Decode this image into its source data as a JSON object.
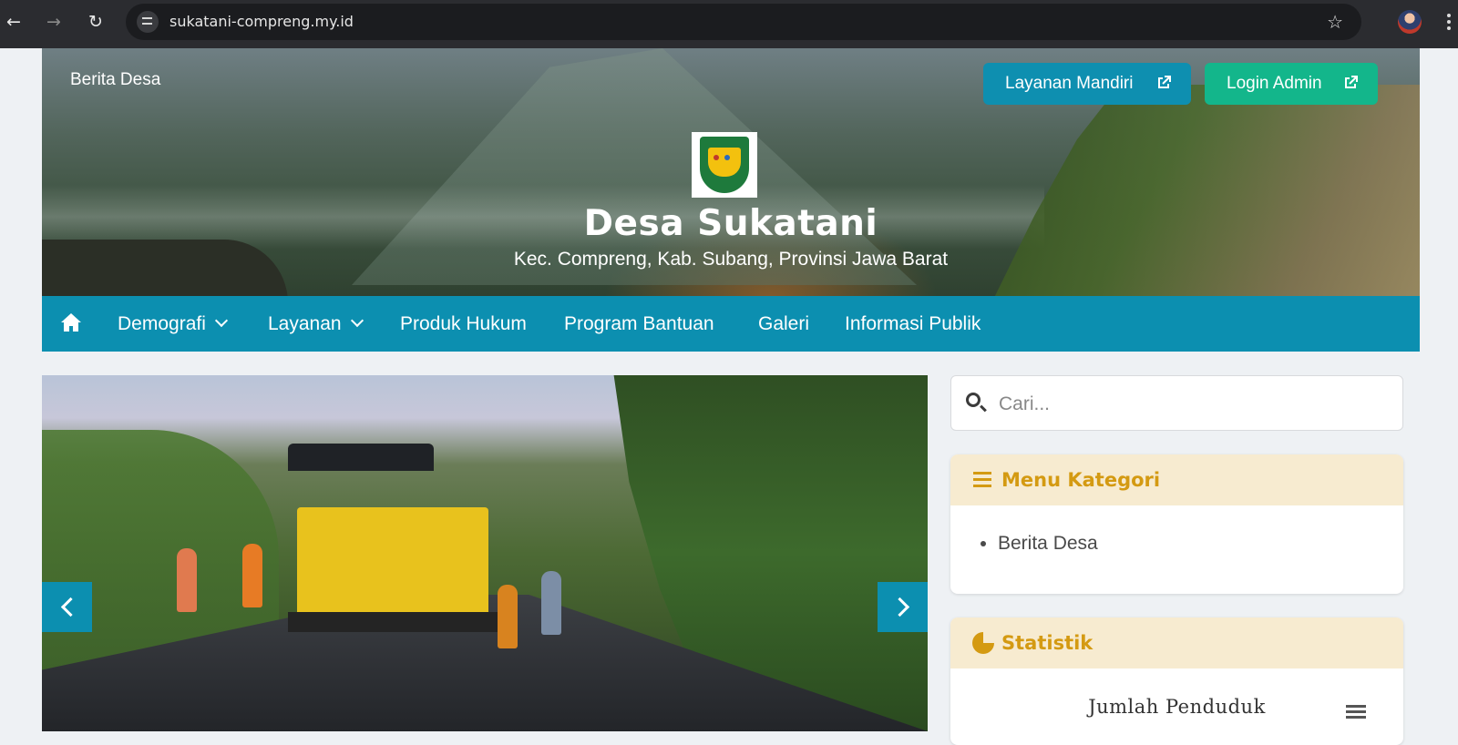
{
  "browser": {
    "url": "sukatani-compreng.my.id"
  },
  "header": {
    "top_link": "Berita Desa",
    "buttons": {
      "mandiri": "Layanan Mandiri",
      "admin": "Login Admin"
    },
    "title": "Desa Sukatani",
    "subtitle": "Kec. Compreng, Kab. Subang, Provinsi Jawa Barat"
  },
  "nav": {
    "items": [
      {
        "label": "Demografi",
        "dropdown": true
      },
      {
        "label": "Layanan",
        "dropdown": true
      },
      {
        "label": "Produk Hukum",
        "dropdown": false
      },
      {
        "label": "Program Bantuan",
        "dropdown": false
      },
      {
        "label": "Galeri",
        "dropdown": false
      },
      {
        "label": "Informasi Publik",
        "dropdown": false
      }
    ]
  },
  "sidebar": {
    "search_placeholder": "Cari...",
    "kategori": {
      "title": "Menu Kategori",
      "items": [
        "Berita Desa"
      ]
    },
    "statistik": {
      "title": "Statistik",
      "chart_title": "Jumlah Penduduk"
    }
  },
  "colors": {
    "primary": "#0c8fb0",
    "success": "#13b68b",
    "accent": "#d49a12",
    "card_header": "#f7ebd0"
  },
  "icons": [
    "back-arrow-icon",
    "forward-arrow-icon",
    "reload-icon",
    "site-info-icon",
    "bookmark-star-icon",
    "external-link-icon",
    "home-icon",
    "chevron-down-icon",
    "chevron-left-icon",
    "chevron-right-icon",
    "search-icon",
    "bars-icon",
    "pie-chart-icon",
    "hamburger-menu-icon"
  ]
}
